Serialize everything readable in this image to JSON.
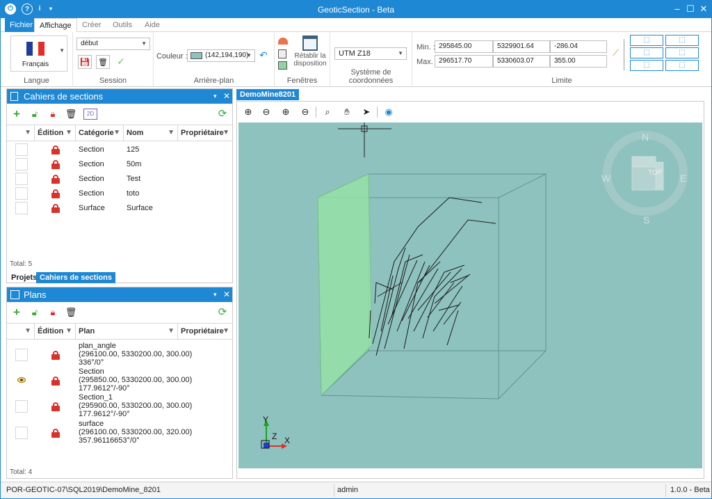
{
  "window": {
    "title": "GeoticSection - Beta"
  },
  "menu": {
    "file": "Fichier",
    "tabs": [
      "Affichage",
      "Créer",
      "Outils",
      "Aide"
    ]
  },
  "ribbon": {
    "language": {
      "value": "Français",
      "label": "Langue"
    },
    "session": {
      "value": "début",
      "label": "Session"
    },
    "background": {
      "prefix": "Couleur :",
      "value": "(142,194,190)",
      "swatch": "#8ec2be",
      "label": "Arrière-plan"
    },
    "windows": {
      "reset_label": "Rétablir la disposition",
      "label": "Fenêtres"
    },
    "coords": {
      "value": "UTM Z18",
      "label": "Système de coordonnées"
    },
    "limits": {
      "min_label": "Min. :",
      "max_label": "Max. :",
      "min": [
        "295845.00",
        "5329901.64",
        "-286.04"
      ],
      "max": [
        "296517.70",
        "5330603.07",
        "355.00"
      ],
      "label": "Limite"
    }
  },
  "sections_panel": {
    "title": "Cahiers de sections",
    "columns": [
      "Édition",
      "Catégorie",
      "Nom",
      "Propriétaire"
    ],
    "rows": [
      {
        "category": "Section",
        "name": "125"
      },
      {
        "category": "Section",
        "name": "50m"
      },
      {
        "category": "Section",
        "name": "Test"
      },
      {
        "category": "Section",
        "name": "toto"
      },
      {
        "category": "Surface",
        "name": "Surface"
      }
    ],
    "total": "Total: 5",
    "tabs": [
      "Projets",
      "Cahiers de sections"
    ]
  },
  "plans_panel": {
    "title": "Plans",
    "columns": [
      "Édition",
      "Plan",
      "Propriétaire"
    ],
    "rows": [
      {
        "lines": [
          "plan_angle",
          "(296100.00, 5330200.00, 300.00)",
          "336°/0°"
        ],
        "visible": false
      },
      {
        "lines": [
          "Section",
          "(295850.00, 5330200.00, 300.00)",
          "177.9612°/-90°"
        ],
        "visible": true
      },
      {
        "lines": [
          "Section_1",
          "(295900.00, 5330200.00, 300.00)",
          "177.9612°/-90°"
        ],
        "visible": false
      },
      {
        "lines": [
          "surface",
          "(296100.00, 5330200.00, 320.00)",
          "357.96116653°/0°"
        ],
        "visible": false
      }
    ],
    "total": "Total: 4"
  },
  "viewport": {
    "tab": "DemoMine8201",
    "background": "#8ec2be",
    "compass": {
      "n": "N",
      "s": "S",
      "e": "E",
      "w": "W",
      "face": "TOP"
    },
    "axes": {
      "x": "X",
      "y": "Y",
      "z": "Z"
    }
  },
  "status": {
    "connection": "POR-GEOTIC-07\\SQL2019\\DemoMine_8201",
    "user": "admin",
    "version": "1.0.0 - Beta"
  }
}
